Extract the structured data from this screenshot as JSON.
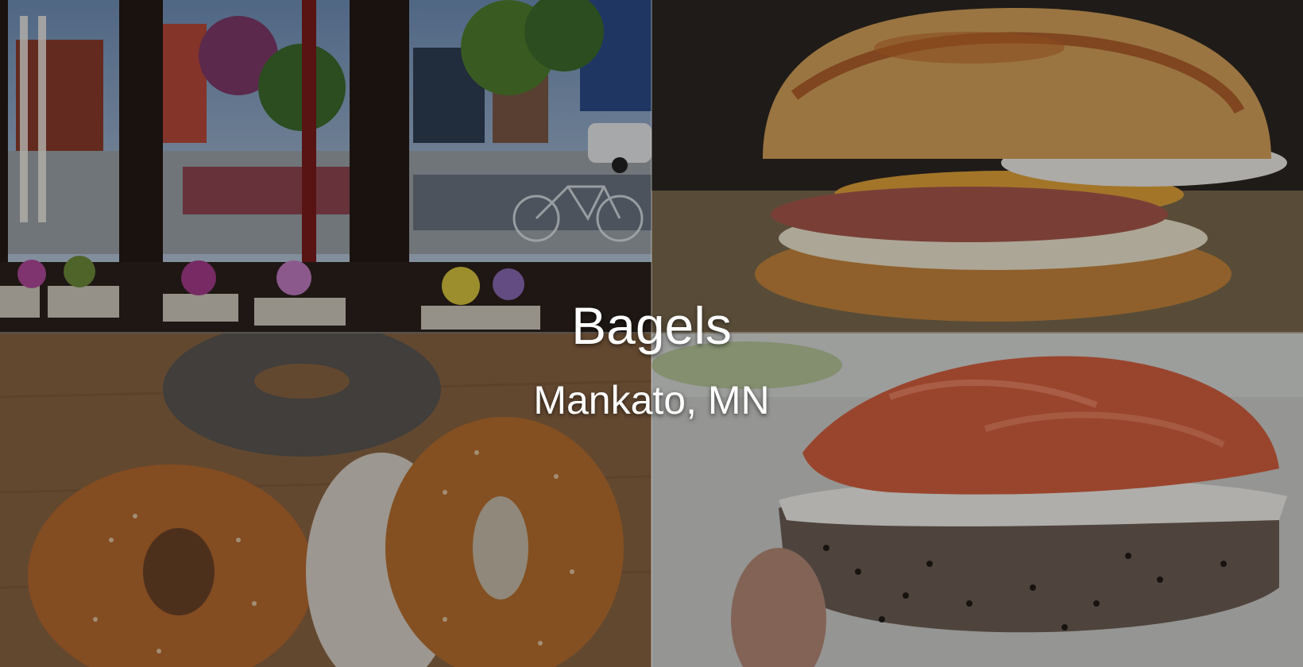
{
  "hero": {
    "title": "Bagels",
    "subtitle": "Mankato, MN"
  },
  "tiles": [
    {
      "name": "storefront-photo"
    },
    {
      "name": "breakfast-bagel-sandwich-photo"
    },
    {
      "name": "sesame-poppy-bagels-photo"
    },
    {
      "name": "lox-cream-cheese-bagel-photo"
    }
  ],
  "colors": {
    "text": "#ffffff",
    "overlay": "rgba(0,0,0,0.28)"
  }
}
